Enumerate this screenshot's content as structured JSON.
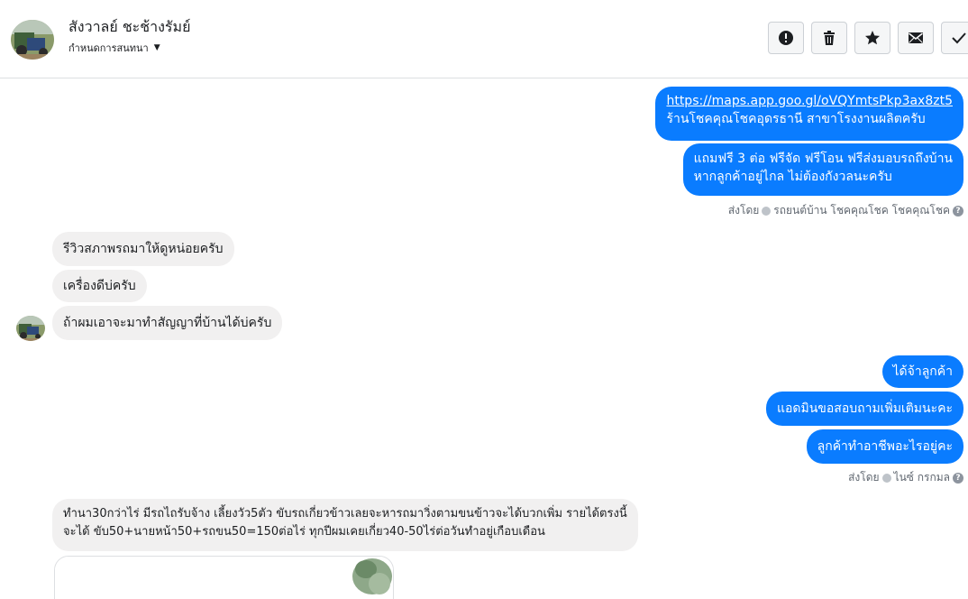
{
  "header": {
    "contact_name": "สังวาลย์ ชะช้างรัมย์",
    "assign_label": "กำหนดการสนทนา",
    "actions": [
      {
        "icon": "alert-icon"
      },
      {
        "icon": "trash-icon"
      },
      {
        "icon": "star-icon"
      },
      {
        "icon": "mail-icon"
      },
      {
        "icon": "check-icon"
      }
    ]
  },
  "messages": {
    "out1_link": "https://maps.app.goo.gl/oVQYmtsPkp3ax8zt5",
    "out1_text": "ร้านโชคคุณโชคอุดรธานี สาขาโรงงานผลิตครับ",
    "out2_line1": "แถมฟรี 3 ต่อ ฟรีจัด ฟรีโอน  ฟรีส่งมอบรถถึงบ้าน",
    "out2_line2": "หากลูกค้าอยู่ไกล ไม่ต้องกังวลนะครับ",
    "sent_by_1": "ส่งโดย",
    "sender_1": "รถยนต์บ้าน โชคคุณโชค โชคคุณโชค",
    "in1": "รีวิวสภาพรถมาให้ดูหน่อยครับ",
    "in2": "เครื่องดีบ่ครับ",
    "in3": "ถ้าผมเอาจะมาทำสัญญาที่บ้านได้บ่ครับ",
    "out3": "ได้จ้าลูกค้า",
    "out4": "แอดมินขอสอบถามเพิ่มเติมนะคะ",
    "out5": "ลูกค้าทำอาชีพอะไรอยู่คะ",
    "sent_by_2": "ส่งโดย",
    "sender_2": "ไนซ์ กรกมล",
    "in4_line1": "ทำนา30กว่าไร่ มีรถไถรับจ้าง เลี้ยงวัว5ตัว ขับรถเกี่ยวข้าวเลยจะหารถมาวิ่งตามขนข้าวจะได้บวกเพิ่ม รายได้ตรงนี้",
    "in4_line2": "จะได้ ขับ50+นายหน้า50+รถขน50=150ต่อไร่ ทุกปีผมเคยเกี่ยว40-50ไร่ต่อวันทำอยู่เกือบเดือน"
  },
  "colors": {
    "outgoing": "#0a7cff",
    "incoming": "#f1f0f0"
  }
}
